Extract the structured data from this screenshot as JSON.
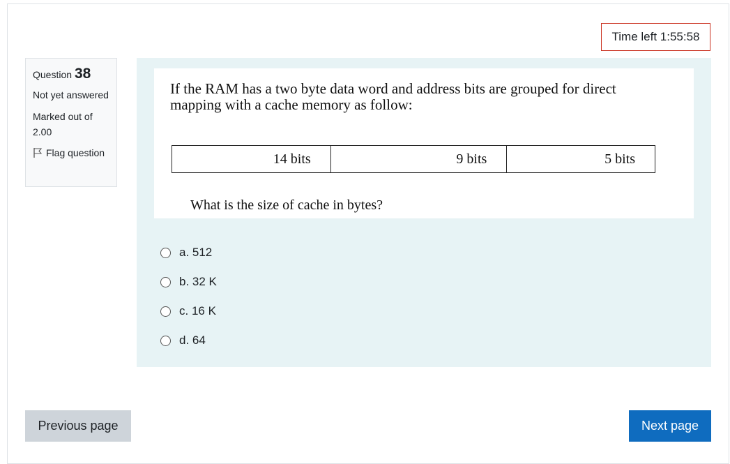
{
  "timer": {
    "label": "Time left 1:55:58"
  },
  "question_info": {
    "question_label": "Question",
    "question_number": "38",
    "state": "Not yet answered",
    "grade": "Marked out of 2.00",
    "flag_label": "Flag question"
  },
  "question": {
    "text": "If the RAM has a two byte data word and address bits are grouped for direct mapping with a cache memory as follow:",
    "fields": [
      "14 bits",
      "9 bits",
      "5 bits"
    ],
    "prompt": "What is the size of cache in bytes?"
  },
  "answers": [
    {
      "label": "a. 512"
    },
    {
      "label": "b. 32 K"
    },
    {
      "label": "c. 16 K"
    },
    {
      "label": "d. 64"
    }
  ],
  "navigation": {
    "previous_label": "Previous page",
    "next_label": "Next page"
  },
  "colors": {
    "timer_border": "#ca3120",
    "content_bg": "#e7f3f5",
    "next_button": "#0f6cbf",
    "previous_button": "#ced4da"
  },
  "icons": {
    "flag": "flag-icon"
  }
}
